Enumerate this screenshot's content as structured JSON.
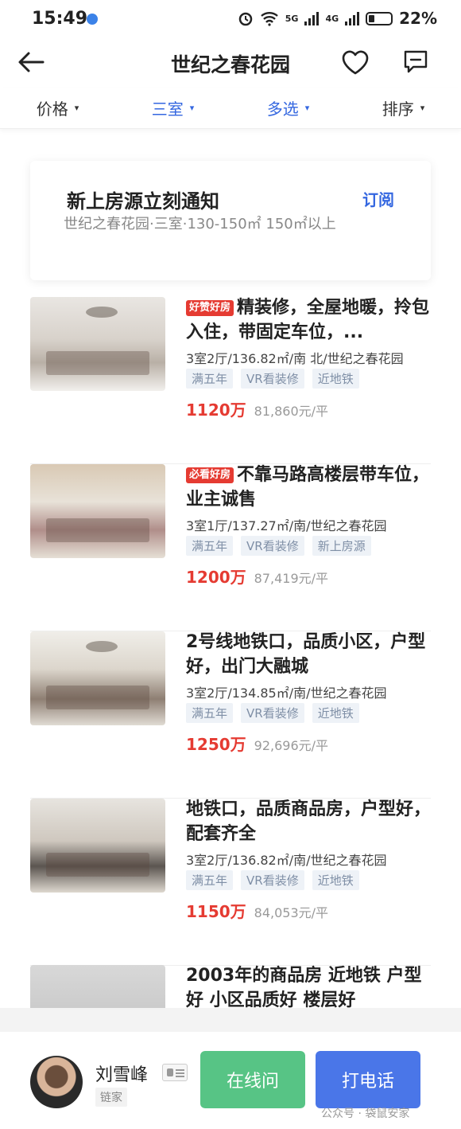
{
  "status_bar": {
    "time": "15:49",
    "battery": "22%",
    "net_5g": "5G",
    "net_4g": "4G",
    "hd_label": "6"
  },
  "header": {
    "title": "世纪之春花园"
  },
  "filters": [
    {
      "label": "价格",
      "active": false
    },
    {
      "label": "三室",
      "active": true
    },
    {
      "label": "多选",
      "active": true
    },
    {
      "label": "排序",
      "active": false
    }
  ],
  "subscribe": {
    "title": "新上房源立刻通知",
    "link": "订阅",
    "description": "世纪之春花园·三室·130-150㎡ 150㎡以上"
  },
  "listings": [
    {
      "badge": "好赞好房",
      "title": "精装修，全屋地暖，拎包入住，带固定车位，...",
      "desc": "3室2厅/136.82㎡/南 北/世纪之春花园",
      "tags": [
        "满五年",
        "VR看装修",
        "近地铁"
      ],
      "price": "1120万",
      "unit_price": "81,860元/平"
    },
    {
      "badge": "必看好房",
      "title": "不靠马路高楼层带车位，业主诚售",
      "desc": "3室1厅/137.27㎡/南/世纪之春花园",
      "tags": [
        "满五年",
        "VR看装修",
        "新上房源"
      ],
      "price": "1200万",
      "unit_price": "87,419元/平"
    },
    {
      "badge": "",
      "title": "2号线地铁口，品质小区，户型好，出门大融城",
      "desc": "3室2厅/134.85㎡/南/世纪之春花园",
      "tags": [
        "满五年",
        "VR看装修",
        "近地铁"
      ],
      "price": "1250万",
      "unit_price": "92,696元/平"
    },
    {
      "badge": "",
      "title": "地铁口，品质商品房，户型好，配套齐全",
      "desc": "3室2厅/136.82㎡/南/世纪之春花园",
      "tags": [
        "满五年",
        "VR看装修",
        "近地铁"
      ],
      "price": "1150万",
      "unit_price": "84,053元/平"
    },
    {
      "badge": "",
      "title": "2003年的商品房 近地铁 户型好 小区品质好 楼层好",
      "desc": "",
      "tags": [],
      "price": "",
      "unit_price": ""
    }
  ],
  "agent": {
    "name": "刘雪峰",
    "company": "链家",
    "chat_label": "在线问",
    "call_label": "打电话"
  },
  "watermark": "公众号 · 袋鼠安家",
  "colors": {
    "accent_blue": "#3467e0",
    "price_red": "#e53b32",
    "chat_green": "#57c485",
    "call_blue": "#4a76e8"
  }
}
